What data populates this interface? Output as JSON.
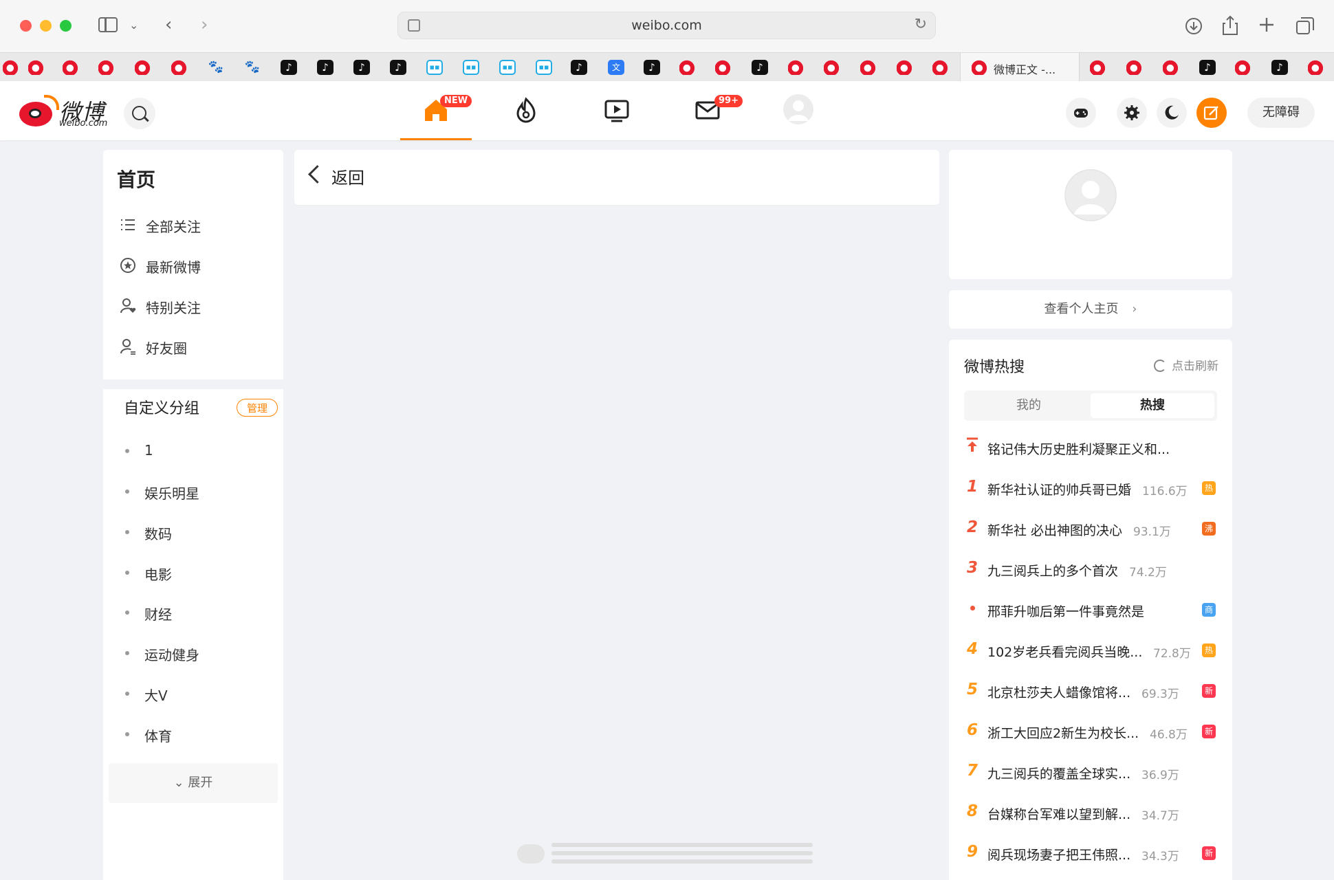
{
  "browser": {
    "url": "weibo.com",
    "active_tab_title": "微博正文 -..."
  },
  "header": {
    "logo_cn": "微博",
    "logo_en": "weibo.com",
    "home_badge": "NEW",
    "message_badge": "99+",
    "accessibility_label": "无障碍"
  },
  "left": {
    "title": "首页",
    "nav": [
      {
        "label": "全部关注",
        "icon": "list-icon"
      },
      {
        "label": "最新微博",
        "icon": "clock-star-icon"
      },
      {
        "label": "特别关注",
        "icon": "user-heart-icon"
      },
      {
        "label": "好友圈",
        "icon": "user-friends-icon"
      }
    ],
    "groups_title": "自定义分组",
    "manage_label": "管理",
    "groups": [
      "1",
      "娱乐明星",
      "数码",
      "电影",
      "财经",
      "运动健身",
      "大V",
      "体育"
    ],
    "expand_label": "展开"
  },
  "center": {
    "back_label": "返回"
  },
  "right": {
    "profile_link": "查看个人主页",
    "hot": {
      "title": "微博热搜",
      "refresh_label": "点击刷新",
      "tabs": [
        "我的",
        "热搜"
      ],
      "active_tab": "热搜",
      "items": [
        {
          "rank": "",
          "rank_type": "pinned",
          "text": "铭记伟大历史胜利凝聚正义和...",
          "count": "",
          "tag": ""
        },
        {
          "rank": "1",
          "rank_type": "top",
          "text": "新华社认证的帅兵哥已婚",
          "count": "116.6万",
          "tag": "热"
        },
        {
          "rank": "2",
          "rank_type": "top",
          "text": "新华社 必出神图的决心",
          "count": "93.1万",
          "tag": "沸"
        },
        {
          "rank": "3",
          "rank_type": "top",
          "text": "九三阅兵上的多个首次",
          "count": "74.2万",
          "tag": ""
        },
        {
          "rank": "",
          "rank_type": "ad",
          "text": "邢菲升咖后第一件事竟然是",
          "count": "",
          "tag": "商"
        },
        {
          "rank": "4",
          "rank_type": "normal",
          "text": "102岁老兵看完阅兵当晚...",
          "count": "72.8万",
          "tag": "热"
        },
        {
          "rank": "5",
          "rank_type": "normal",
          "text": "北京杜莎夫人蜡像馆将...",
          "count": "69.3万",
          "tag": "新"
        },
        {
          "rank": "6",
          "rank_type": "normal",
          "text": "浙工大回应2新生为校长...",
          "count": "46.8万",
          "tag": "新"
        },
        {
          "rank": "7",
          "rank_type": "normal",
          "text": "九三阅兵的覆盖全球实...",
          "count": "36.9万",
          "tag": ""
        },
        {
          "rank": "8",
          "rank_type": "normal",
          "text": "台媒称台军难以望到解...",
          "count": "34.7万",
          "tag": ""
        },
        {
          "rank": "9",
          "rank_type": "normal",
          "text": "阅兵现场妻子把王伟照...",
          "count": "34.3万",
          "tag": "新"
        }
      ]
    }
  },
  "colors": {
    "accent": "#ff8200",
    "rank_top": "#f0573a",
    "rank_normal": "#ff9a1a",
    "tag_hot": "#ffa41b",
    "tag_boil": "#f26d1f",
    "tag_new": "#ff3852",
    "tag_ad": "#4aa3f0"
  }
}
